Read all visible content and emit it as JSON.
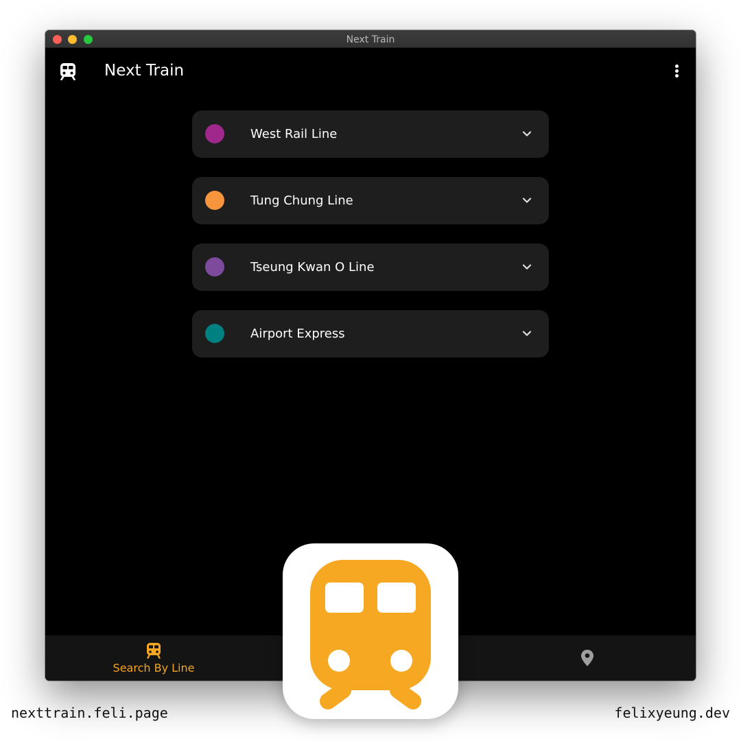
{
  "window": {
    "title": "Next Train"
  },
  "appbar": {
    "title": "Next Train",
    "logo_icon": "train-icon",
    "menu_icon": "more-vert-icon"
  },
  "lines": [
    {
      "name": "West Rail Line",
      "color": "#a0288c"
    },
    {
      "name": "Tung Chung Line",
      "color": "#f7943e"
    },
    {
      "name": "Tseung Kwan O Line",
      "color": "#7d4a9c"
    },
    {
      "name": "Airport Express",
      "color": "#008080"
    }
  ],
  "bottom_nav": {
    "items": [
      {
        "label": "Search By Line",
        "icon": "train-icon",
        "active": true,
        "color": "#f5a623"
      },
      {
        "label": "",
        "icon": "location-pin-icon",
        "active": false,
        "color": "#9e9e9e"
      }
    ]
  },
  "overlay": {
    "app_icon": "train-app-icon",
    "accent": "#f7a823"
  },
  "footer": {
    "left": "nexttrain.feli.page",
    "right": "felixyeung.dev"
  }
}
